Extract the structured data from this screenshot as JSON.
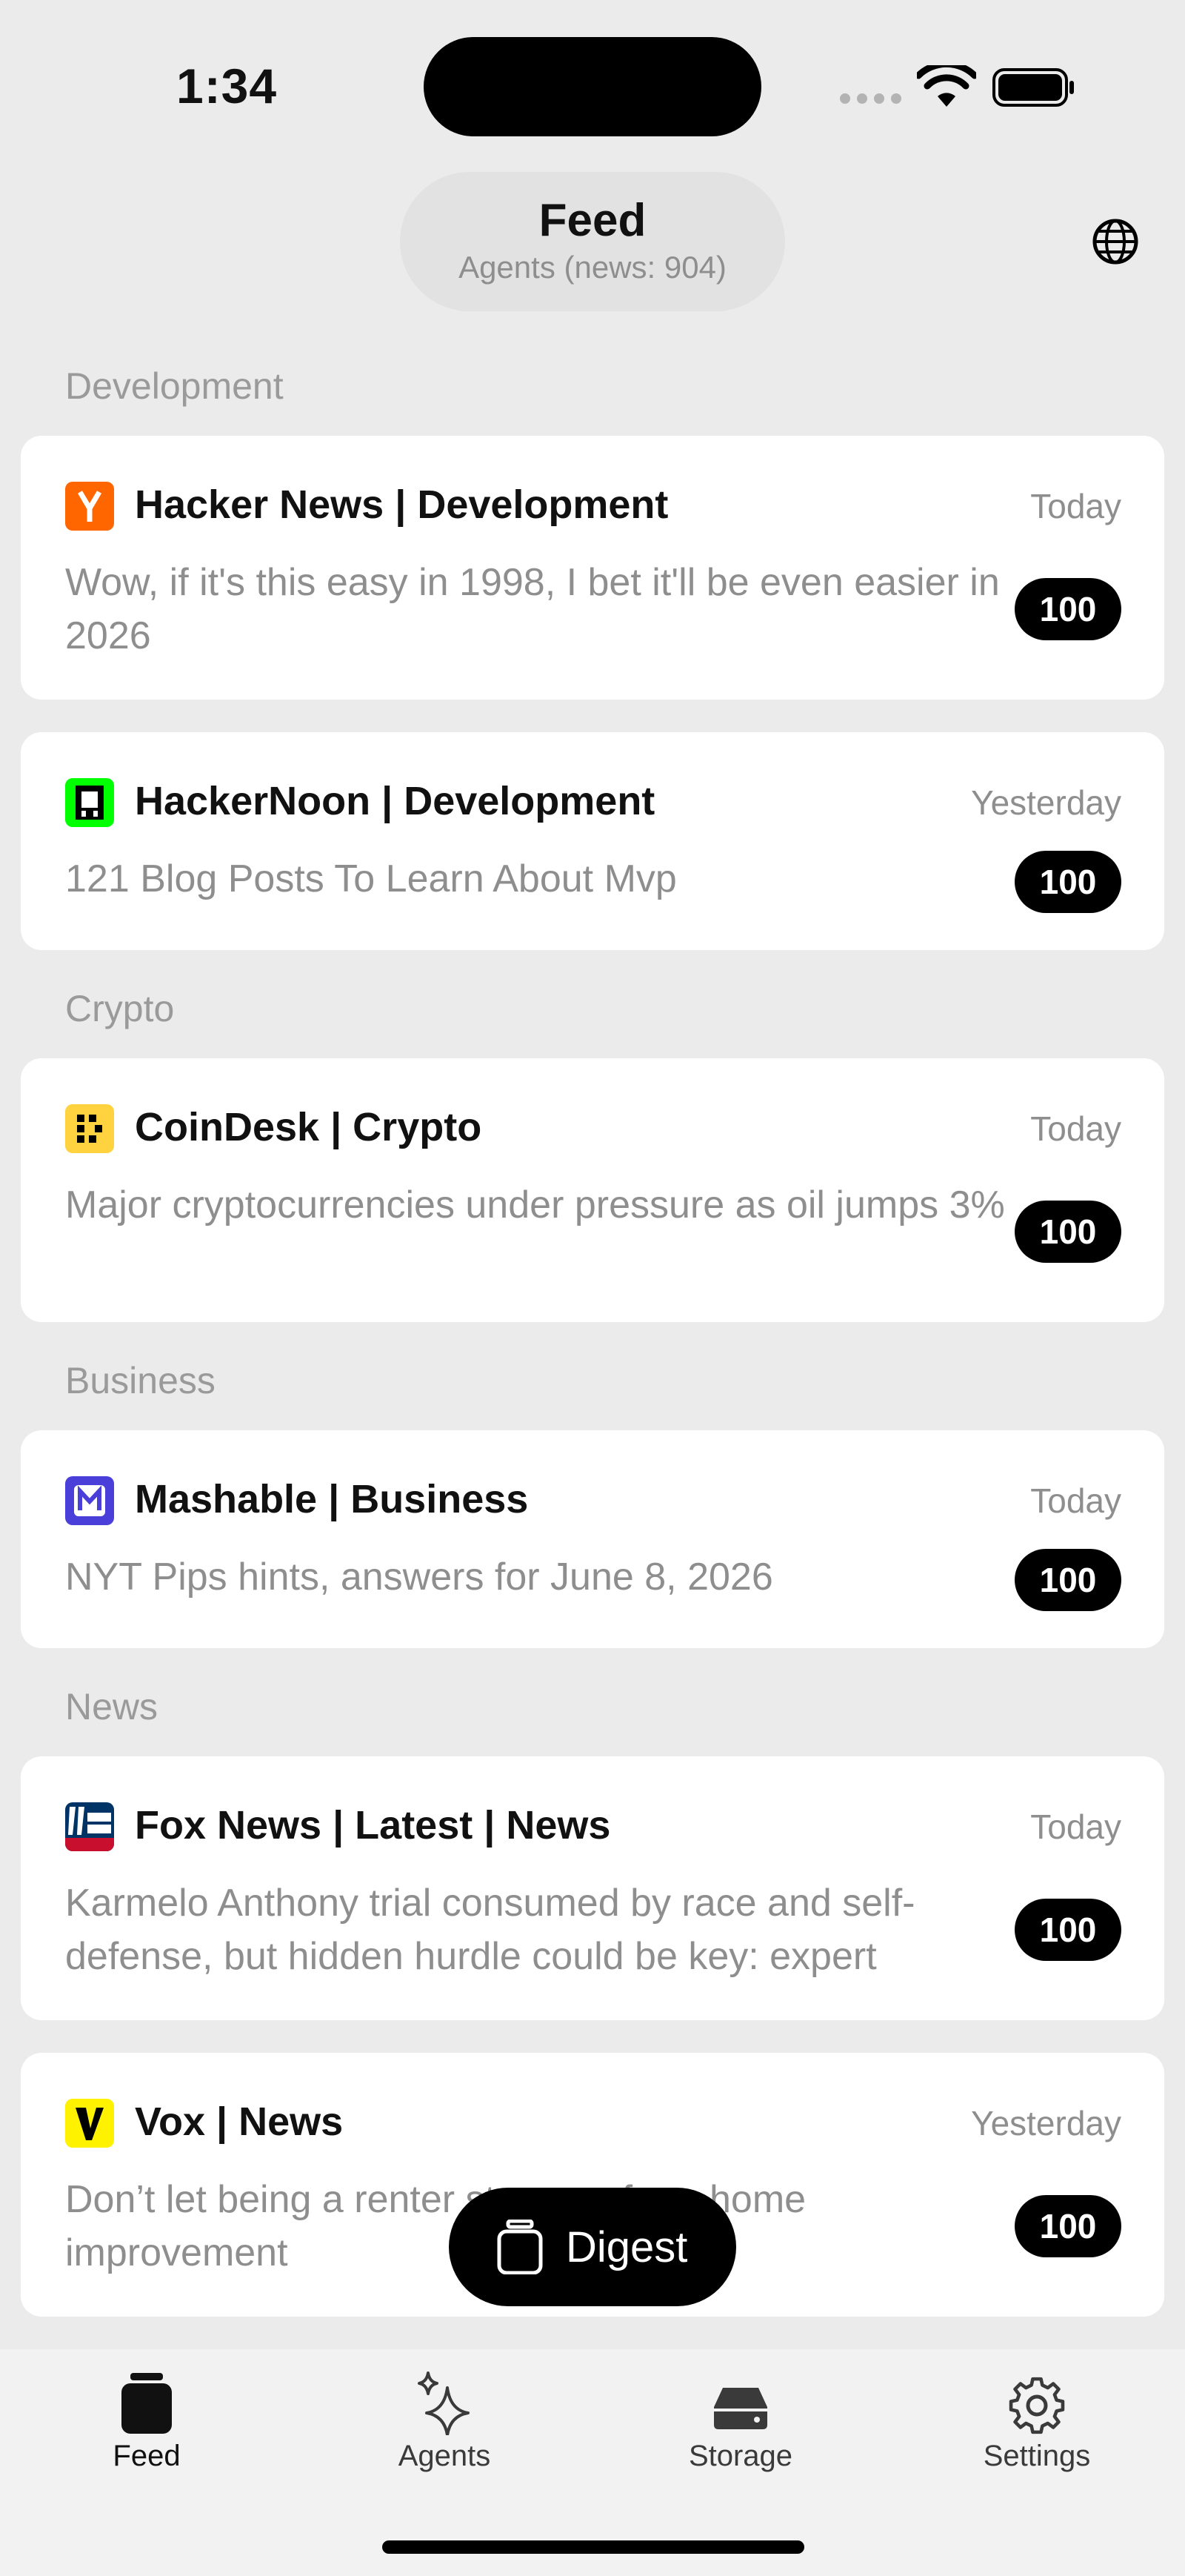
{
  "status_bar": {
    "time": "1:34"
  },
  "header": {
    "title": "Feed",
    "subtitle": "Agents (news: 904)"
  },
  "sections": [
    {
      "label": "Development"
    },
    {
      "label": "Crypto"
    },
    {
      "label": "Business"
    },
    {
      "label": "News"
    }
  ],
  "items": [
    {
      "source": "Hacker News | Development",
      "date": "Today",
      "summary": "Wow, if it's this easy in 1998, I bet it'll be even easier in 2026",
      "score": "100",
      "icon": "hacker-news-logo-icon",
      "icon_color": "#ff6600"
    },
    {
      "source": "HackerNoon | Development",
      "date": "Yesterday",
      "summary": "121 Blog Posts To Learn About Mvp",
      "score": "100",
      "icon": "hackernoon-logo-icon",
      "icon_color": "#00ff00"
    },
    {
      "source": "CoinDesk | Crypto",
      "date": "Today",
      "summary": "Major cryptocurrencies under pressure as oil jumps 3%",
      "score": "100",
      "icon": "coindesk-logo-icon",
      "icon_color": "#ffd23f"
    },
    {
      "source": "Mashable | Business",
      "date": "Today",
      "summary": "NYT Pips hints, answers for June 8, 2026",
      "score": "100",
      "icon": "mashable-logo-icon",
      "icon_color": "#4a3fd9"
    },
    {
      "source": "Fox News | Latest | News",
      "date": "Today",
      "summary": "Karmelo Anthony trial consumed by race and self-defense, but hidden hurdle could be key: expert",
      "score": "100",
      "icon": "fox-news-logo-icon",
      "icon_color": "#003366"
    },
    {
      "source": "Vox | News",
      "date": "Yesterday",
      "summary": "Don’t let being a renter stop you from home improvement",
      "score": "100",
      "icon": "vox-logo-icon",
      "icon_color": "#fff200"
    }
  ],
  "digest_button": {
    "label": "Digest"
  },
  "tabs": [
    {
      "label": "Feed",
      "icon": "feed-jar-icon",
      "active": true
    },
    {
      "label": "Agents",
      "icon": "sparkle-icon",
      "active": false
    },
    {
      "label": "Storage",
      "icon": "drive-icon",
      "active": false
    },
    {
      "label": "Settings",
      "icon": "gear-icon",
      "active": false
    }
  ]
}
